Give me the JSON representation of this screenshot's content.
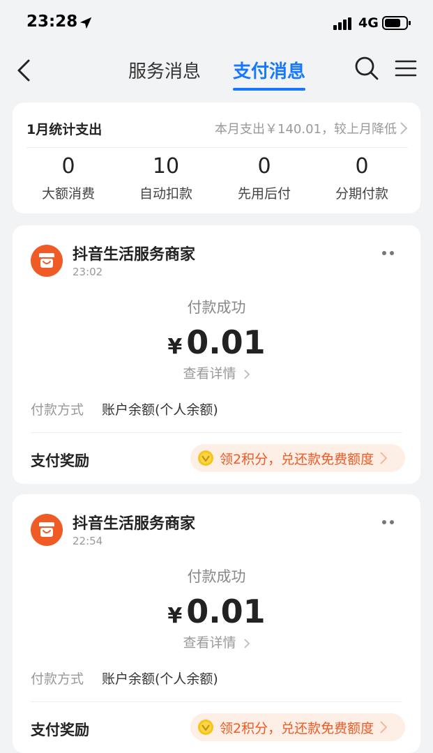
{
  "status_bar": {
    "time": "23:28",
    "network": "4G"
  },
  "nav": {
    "tabs": [
      {
        "label": "服务消息"
      },
      {
        "label": "支付消息"
      }
    ]
  },
  "stats": {
    "title": "1月统计支出",
    "summary": "本月支出￥140.01，较上月降低",
    "items": [
      {
        "value": "0",
        "label": "大额消费"
      },
      {
        "value": "10",
        "label": "自动扣款"
      },
      {
        "value": "0",
        "label": "先用后付"
      },
      {
        "value": "0",
        "label": "分期付款"
      }
    ]
  },
  "payments": [
    {
      "merchant": "抖音生活服务商家",
      "time": "23:02",
      "status": "付款成功",
      "currency": "¥",
      "amount": "0.01",
      "detail_label": "查看详情",
      "method_label": "付款方式",
      "method_value": "账户余额(个人余额)",
      "reward_label": "支付奖励",
      "reward_text": "领2积分，兑还款免费额度"
    },
    {
      "merchant": "抖音生活服务商家",
      "time": "22:54",
      "status": "付款成功",
      "currency": "¥",
      "amount": "0.01",
      "detail_label": "查看详情",
      "method_label": "付款方式",
      "method_value": "账户余额(个人余额)",
      "reward_label": "支付奖励",
      "reward_text": "领2积分，兑还款免费额度"
    }
  ],
  "colors": {
    "accent": "#1677ff",
    "merchant": "#f05a24",
    "reward_bg": "#fdeee6",
    "background": "#f2f3f5"
  },
  "icons": [
    "location-arrow-icon",
    "signal-icon",
    "battery-icon",
    "back-icon",
    "search-icon",
    "menu-icon",
    "store-icon",
    "more-icon",
    "chevron-right-icon",
    "coin-icon"
  ]
}
